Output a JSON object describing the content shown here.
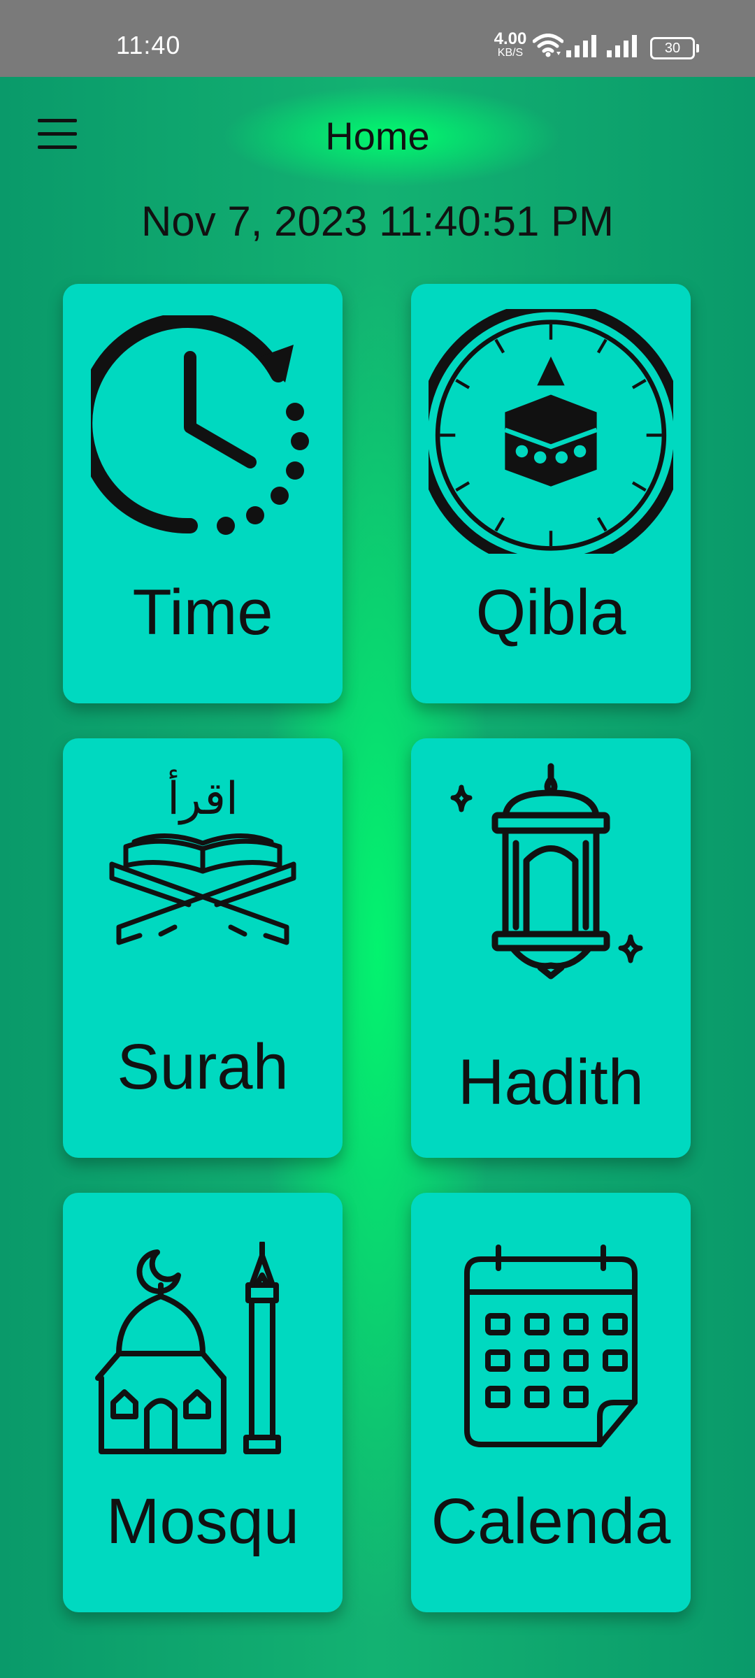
{
  "status_bar": {
    "time": "11:40",
    "net_speed_value": "4.00",
    "net_speed_unit": "KB/S",
    "battery": "30"
  },
  "app_bar": {
    "title": "Home",
    "menu_icon": "hamburger-menu-icon"
  },
  "datetime": "Nov 7, 2023 11:40:51 PM",
  "cards": [
    {
      "label": "Time",
      "icon": "clock-icon"
    },
    {
      "label": "Qibla",
      "icon": "qibla-compass-icon"
    },
    {
      "label": "Surah",
      "icon": "quran-icon"
    },
    {
      "label": "Hadith",
      "icon": "lantern-icon"
    },
    {
      "label": "Mosqu",
      "icon": "mosque-icon"
    },
    {
      "label": "Calenda",
      "icon": "calendar-icon"
    }
  ],
  "surah_icon_text": "اقرأ",
  "colors": {
    "status_bar": "#7a7a7a",
    "background": "#0aa46c",
    "glow": "#00ff6e",
    "card": "#00d9c0",
    "text": "#111111"
  }
}
